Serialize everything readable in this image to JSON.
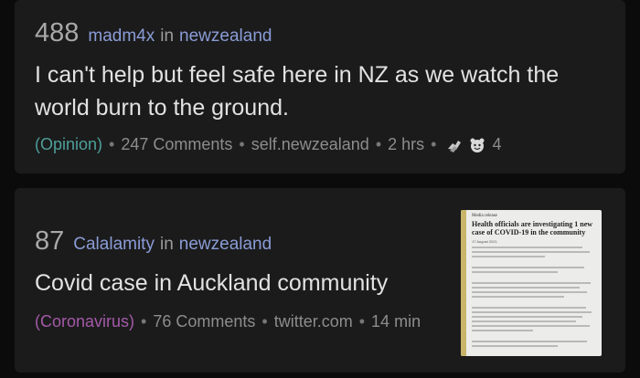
{
  "posts": [
    {
      "score": "488",
      "author": "madm4x",
      "in_label": "in",
      "subreddit": "newzealand",
      "title": "I can't help but feel safe here in NZ as we watch the world burn to the ground.",
      "flair": "(Opinion)",
      "comments": "247 Comments",
      "domain": "self.newzealand",
      "time": "2 hrs",
      "award_icons": [
        "awards-hands-icon",
        "wholesome-award-icon"
      ],
      "award_count": "4",
      "flair_color": "#4e9f9b"
    },
    {
      "score": "87",
      "author": "Calalamity",
      "in_label": "in",
      "subreddit": "newzealand",
      "title": "Covid case in Auckland community",
      "flair": "(Coronavirus)",
      "comments": "76 Comments",
      "domain": "twitter.com",
      "time": "14 min",
      "flair_color": "#a35aa8",
      "thumbnail": {
        "kicker": "Media release",
        "headline": "Health officials are investigating 1 new case of COVID-19 in the community",
        "date": "17 August 2021"
      }
    }
  ],
  "separator": "•",
  "colors": {
    "background": "#0b0b0b",
    "card": "#1b1b1b",
    "username": "#8a9cd6",
    "title": "#e2e2e2",
    "meta": "#8d8d8d"
  }
}
